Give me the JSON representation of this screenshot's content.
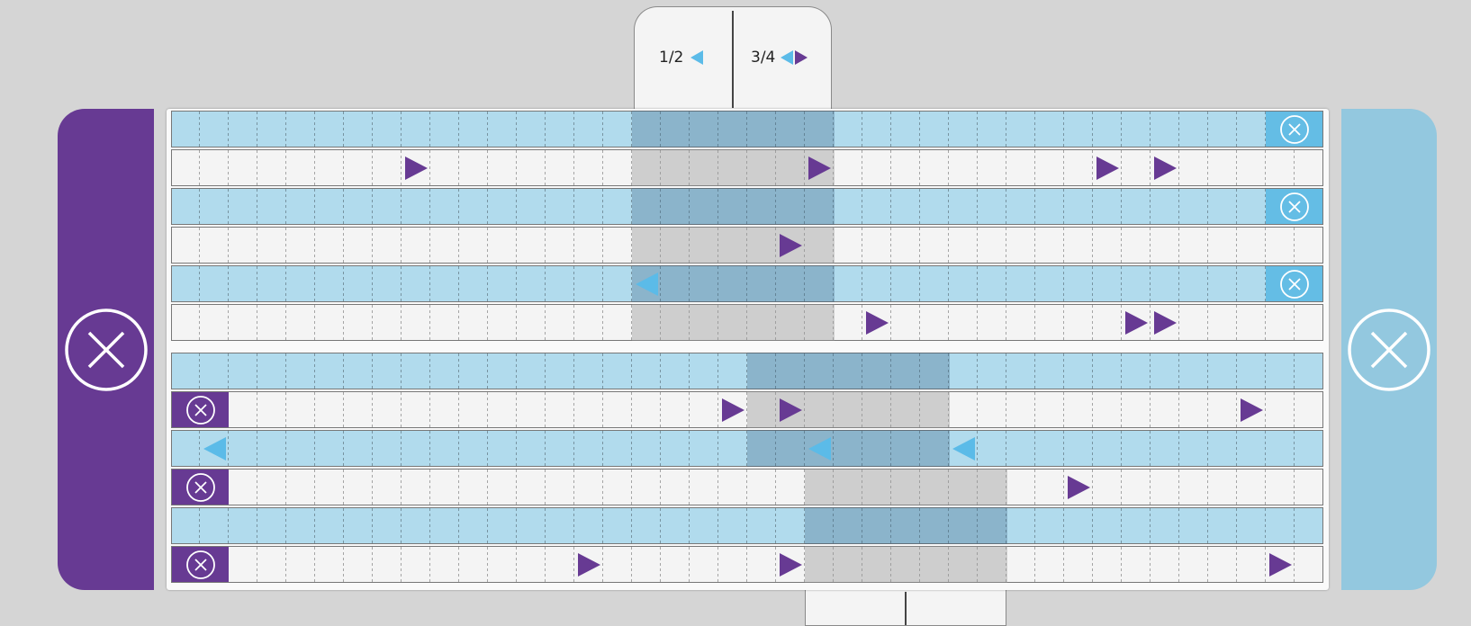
{
  "top_tab": {
    "left_label": "1/2",
    "right_label": "3/4",
    "left_icons": [
      "triangle-left-blue"
    ],
    "right_icons": [
      "triangle-left-blue",
      "triangle-right-purple"
    ]
  },
  "side_panels": {
    "left": {
      "color": "#673a93",
      "icon": "close-circle-icon"
    },
    "right": {
      "color": "#93c8df",
      "icon": "close-circle-icon"
    }
  },
  "colors": {
    "purple": "#673a93",
    "light_blue": "#5bbbe8",
    "row_blue": "#b1dbed",
    "row_white": "#f4f4f4"
  },
  "grid": {
    "columns": 40
  },
  "track_groups": [
    {
      "highlight_columns": [
        16,
        22
      ],
      "rows": [
        {
          "color": "blue",
          "clear_button": "right",
          "notes": []
        },
        {
          "color": "white",
          "clear_button": null,
          "notes": [
            {
              "col": 8,
              "dir": "right"
            },
            {
              "col": 22,
              "dir": "right"
            },
            {
              "col": 32,
              "dir": "right"
            },
            {
              "col": 34,
              "dir": "right"
            }
          ]
        },
        {
          "color": "blue",
          "clear_button": "right",
          "notes": []
        },
        {
          "color": "white",
          "clear_button": null,
          "notes": [
            {
              "col": 21,
              "dir": "right"
            }
          ]
        },
        {
          "color": "blue",
          "clear_button": "right",
          "notes": [
            {
              "col": 16,
              "dir": "left"
            }
          ]
        },
        {
          "color": "white",
          "clear_button": null,
          "notes": [
            {
              "col": 24,
              "dir": "right"
            },
            {
              "col": 33,
              "dir": "right"
            },
            {
              "col": 34,
              "dir": "right"
            }
          ]
        }
      ]
    },
    {
      "highlight_sections": [
        {
          "rows": [
            0,
            2
          ],
          "columns": [
            20,
            26
          ]
        },
        {
          "rows": [
            3,
            5
          ],
          "columns": [
            22,
            28
          ]
        }
      ],
      "rows": [
        {
          "color": "blue",
          "clear_button": null,
          "notes": []
        },
        {
          "color": "white",
          "clear_button": "left",
          "notes": [
            {
              "col": 19,
              "dir": "right"
            },
            {
              "col": 21,
              "dir": "right"
            },
            {
              "col": 37,
              "dir": "right"
            }
          ]
        },
        {
          "color": "blue",
          "clear_button": null,
          "notes": [
            {
              "col": 1,
              "dir": "left"
            },
            {
              "col": 22,
              "dir": "left"
            },
            {
              "col": 27,
              "dir": "left"
            }
          ]
        },
        {
          "color": "white",
          "clear_button": "left",
          "notes": [
            {
              "col": 31,
              "dir": "right"
            }
          ]
        },
        {
          "color": "blue",
          "clear_button": null,
          "notes": []
        },
        {
          "color": "white",
          "clear_button": "left",
          "notes": [
            {
              "col": 14,
              "dir": "right"
            },
            {
              "col": 21,
              "dir": "right"
            },
            {
              "col": 38,
              "dir": "right"
            }
          ]
        }
      ]
    }
  ]
}
